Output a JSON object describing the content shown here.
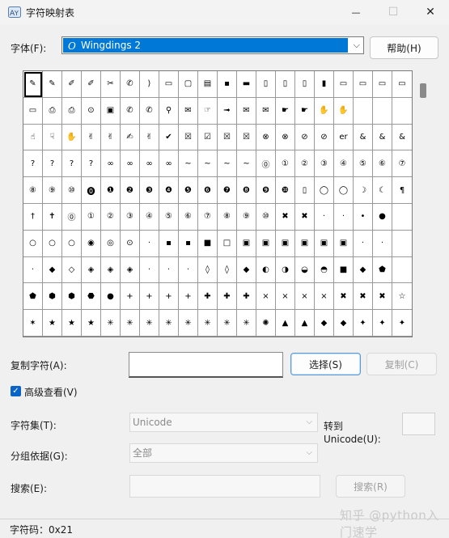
{
  "window": {
    "title": "字符映射表",
    "minimize_glyph": "—",
    "maximize_glyph": "☐",
    "close_glyph": "✕"
  },
  "font": {
    "label": "字体(F):",
    "selected": "Wingdings 2",
    "help_label": "帮助(H)"
  },
  "grid": {
    "selected_index": 0,
    "cells": [
      "✎",
      "✎",
      "✐",
      "✐",
      "✂",
      "✆",
      "⟩",
      "▭",
      "▢",
      "▤",
      "▪",
      "▬",
      "▯",
      "▯",
      "▯",
      "▮",
      "▭",
      "▭",
      "▭",
      "▭",
      "▭",
      "⎙",
      "⎙",
      "⊙",
      "▣",
      "✆",
      "✆",
      "⚲",
      "✉",
      "☞",
      "➟",
      "✉",
      "✉",
      "☛",
      "☛",
      "✋",
      "✋",
      "",
      "",
      "",
      "☝",
      "☟",
      "✋",
      "✌",
      "✌",
      "✍",
      "✌",
      "✔",
      "☒",
      "☑",
      "☒",
      "☒",
      "⊗",
      "⊗",
      "⊘",
      "⊘",
      "er",
      "&",
      "&",
      "&",
      "?",
      "?",
      "?",
      "?",
      "∞",
      "∞",
      "∞",
      "∞",
      "~",
      "~",
      "~",
      "~",
      "⓪",
      "①",
      "②",
      "③",
      "④",
      "⑤",
      "⑥",
      "⑦",
      "⑧",
      "⑨",
      "⑩",
      "⓿",
      "❶",
      "❷",
      "❸",
      "❹",
      "❺",
      "❻",
      "❼",
      "❽",
      "❾",
      "❿",
      "▯",
      "◯",
      "◯",
      "☽",
      "☾",
      "¶",
      "†",
      "✝",
      "⓪",
      "①",
      "②",
      "③",
      "④",
      "⑤",
      "⑥",
      "⑦",
      "⑧",
      "⑨",
      "⑩",
      "✖",
      "✖",
      "·",
      "·",
      "•",
      "●",
      "",
      "○",
      "○",
      "○",
      "◉",
      "◎",
      "⊙",
      "·",
      "▪",
      "▪",
      "■",
      "□",
      "▣",
      "▣",
      "▣",
      "▣",
      "▣",
      "▣",
      "·",
      "·",
      "",
      "·",
      "◆",
      "◇",
      "◈",
      "◈",
      "◈",
      "·",
      "·",
      "·",
      "◊",
      "◊",
      "◆",
      "◐",
      "◑",
      "◒",
      "◓",
      "■",
      "◆",
      "⬟",
      "",
      "⬟",
      "⬢",
      "⬢",
      "⬣",
      "●",
      "+",
      "+",
      "+",
      "+",
      "✚",
      "✚",
      "✚",
      "×",
      "×",
      "×",
      "×",
      "✖",
      "✖",
      "✖",
      "☆",
      "✶",
      "★",
      "★",
      "★",
      "✳",
      "✳",
      "✳",
      "✳",
      "✳",
      "✳",
      "✳",
      "✳",
      "✺",
      "▲",
      "▲",
      "◆",
      "◆",
      "✦",
      "✦",
      "✦"
    ]
  },
  "copy": {
    "label": "复制字符(A):",
    "value": "",
    "select_label": "选择(S)",
    "copy_label": "复制(C)"
  },
  "advanced": {
    "label": "高级查看(V)",
    "checked": true
  },
  "charset": {
    "label": "字符集(T):",
    "value": "Unicode",
    "goto_label_line1": "转到",
    "goto_label_line2": "Unicode(U):",
    "goto_value": ""
  },
  "groupby": {
    "label": "分组依据(G):",
    "value": "全部"
  },
  "search": {
    "label": "搜索(E):",
    "value": "",
    "button_label": "搜索(R)"
  },
  "status": {
    "text": "字符码：0x21"
  },
  "watermark": {
    "text": "知乎 @python入门速学"
  }
}
